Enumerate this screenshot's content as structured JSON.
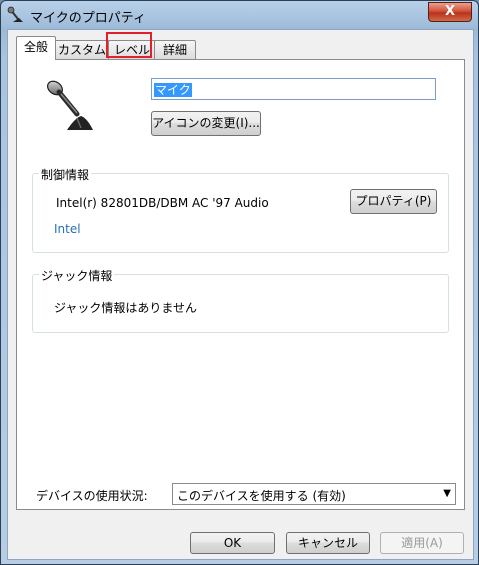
{
  "window": {
    "title": "マイクのプロパティ",
    "close_glyph": "X"
  },
  "tabs": [
    {
      "label": "全般",
      "active": true
    },
    {
      "label": "カスタム"
    },
    {
      "label": "レベル",
      "highlighted": true
    },
    {
      "label": "詳細"
    }
  ],
  "general": {
    "device_name_value": "マイク",
    "change_icon_button": "アイコンの変更(I)...",
    "controller_group": {
      "title": "制御情報",
      "device_text": "Intel(r) 82801DB/DBM AC '97 Audio",
      "vendor_link": "Intel",
      "properties_button": "プロパティ(P)"
    },
    "jack_group": {
      "title": "ジャック情報",
      "message": "ジャック情報はありません"
    },
    "device_usage_label": "デバイスの使用状況:",
    "device_usage_value": "このデバイスを使用する (有効)"
  },
  "buttons": {
    "ok": "OK",
    "cancel": "キャンセル",
    "apply": "適用(A)"
  },
  "colors": {
    "highlight": "#e0202a",
    "link": "#2a6fb5",
    "selection": "#3399ff"
  }
}
